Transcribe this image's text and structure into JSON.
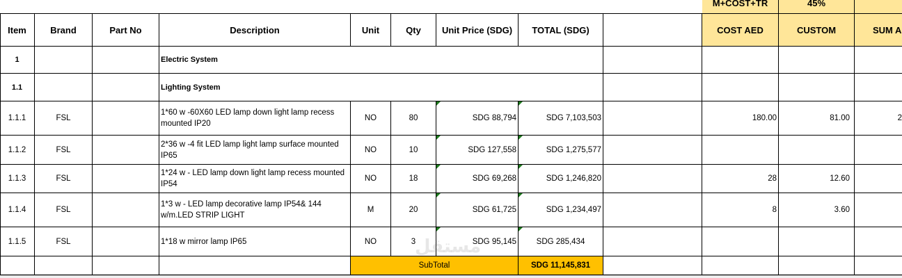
{
  "top_headers": {
    "m_cost_tr": "M+COST+TR",
    "percent": "45%"
  },
  "headers": {
    "item": "Item",
    "brand": "Brand",
    "part_no": "Part No",
    "description": "Description",
    "unit": "Unit",
    "qty": "Qty",
    "unit_price": "Unit Price (SDG)",
    "total": "TOTAL (SDG)",
    "cost_aed": "COST AED",
    "custom": "CUSTOM",
    "sum": "SUM A"
  },
  "sections": [
    {
      "item": "1",
      "description": "Electric System"
    },
    {
      "item": "1.1",
      "description": "Lighting System"
    }
  ],
  "rows": [
    {
      "item": "1.1.1",
      "brand": "FSL",
      "description": "1*60 w -60X60  LED  lamp down light lamp recess  mounted  IP20",
      "unit": "NO",
      "qty": "80",
      "unit_price": "SDG 88,794",
      "total": "SDG 7,103,503",
      "cost_aed": "180.00",
      "custom": "81.00",
      "sum": "2"
    },
    {
      "item": "1.1.2",
      "brand": "FSL",
      "description": "2*36 w -4 fit LED lamp light lamp surface mounted  IP65",
      "unit": "NO",
      "qty": "10",
      "unit_price": "SDG 127,558",
      "total": "SDG 1,275,577",
      "cost_aed": "",
      "custom": "",
      "sum": ""
    },
    {
      "item": "1.1.3",
      "brand": "FSL",
      "description": "1*24 w - LED  lamp down light lamp recess mounted  IP54",
      "unit": "NO",
      "qty": "18",
      "unit_price": "SDG 69,268",
      "total": "SDG 1,246,820",
      "cost_aed": "28",
      "custom": "12.60",
      "sum": ""
    },
    {
      "item": "1.1.4",
      "brand": "FSL",
      "description": "1*3 w -  LED  lamp decorative lamp  IP54&  144 w/m.LED STRIP LIGHT",
      "unit": "M",
      "qty": "20",
      "unit_price": "SDG 61,725",
      "total": "SDG 1,234,497",
      "cost_aed": "8",
      "custom": "3.60",
      "sum": ""
    },
    {
      "item": "1.1.5",
      "brand": "FSL",
      "description": "1*18 w mirror lamp  IP65",
      "unit": "NO",
      "qty": "3",
      "unit_price": "SDG 95,145",
      "total": "SDG 285,434",
      "cost_aed": "",
      "custom": "",
      "sum": ""
    }
  ],
  "subtotal": {
    "label": "SubTotal",
    "value": "SDG 11,145,831"
  },
  "watermark": "مستقل",
  "colors": {
    "header_yellow": "#ffe699",
    "subtotal_gold": "#ffc000",
    "comment_marker": "#1e7a1e"
  }
}
